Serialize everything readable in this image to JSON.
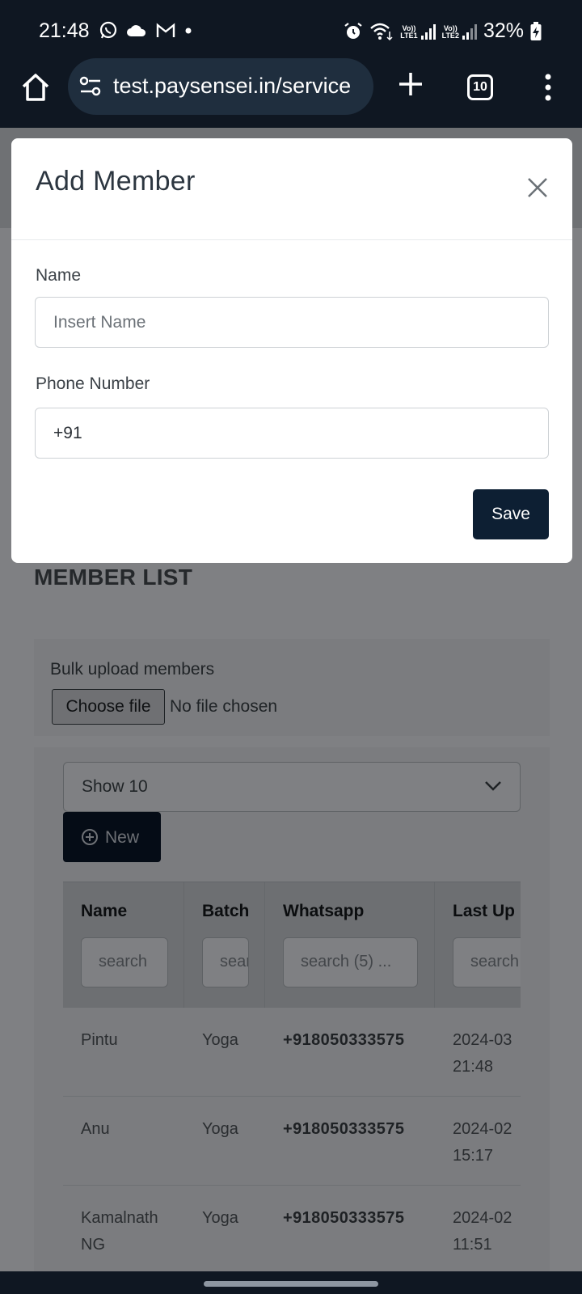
{
  "status_bar": {
    "time": "21:48",
    "battery": "32%",
    "sim1": "LTE1",
    "sim2": "LTE2",
    "volte1": "Vo))",
    "volte2": "Vo))"
  },
  "browser": {
    "url": "test.paysensei.in/service",
    "tab_count": "10"
  },
  "modal": {
    "title": "Add Member",
    "name_label": "Name",
    "name_placeholder": "Insert Name",
    "phone_label": "Phone Number",
    "phone_value": "+91",
    "save_label": "Save"
  },
  "page": {
    "member_list_title": "MEMBER LIST",
    "bulk_upload_label": "Bulk upload members",
    "choose_file_label": "Choose file",
    "no_file_text": "No file chosen",
    "show_select": "Show 10",
    "new_button": "New"
  },
  "table": {
    "columns": [
      {
        "label": "Name",
        "search": "search"
      },
      {
        "label": "Batch",
        "search": "search"
      },
      {
        "label": "Whatsapp",
        "search": "search (5) ..."
      },
      {
        "label": "Last Up",
        "search": "search"
      }
    ],
    "rows": [
      {
        "name": "Pintu",
        "name2": "",
        "batch": "Yoga",
        "whatsapp": "+918050333575",
        "updated_date": "2024-03",
        "updated_time": "21:48"
      },
      {
        "name": "Anu",
        "name2": "",
        "batch": "Yoga",
        "whatsapp": "+918050333575",
        "updated_date": "2024-02",
        "updated_time": "15:17"
      },
      {
        "name": "Kamalnath",
        "name2": "NG",
        "batch": "Yoga",
        "whatsapp": "+918050333575",
        "updated_date": "2024-02",
        "updated_time": "11:51"
      }
    ]
  },
  "colors": {
    "primary_dark": "#0d1f33",
    "status_bar_bg": "#0f1722",
    "url_box_bg": "#1f2e3e"
  }
}
